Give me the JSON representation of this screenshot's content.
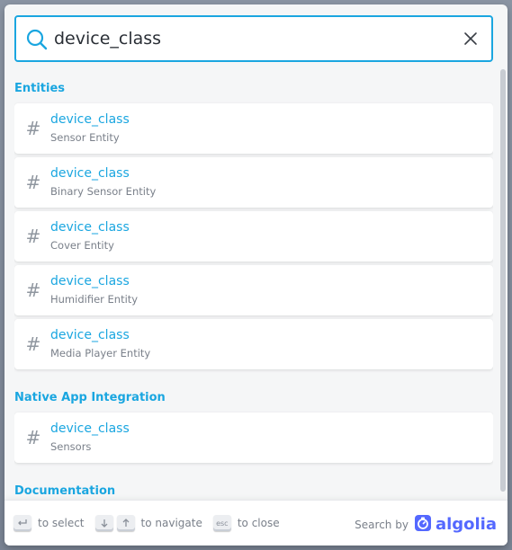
{
  "search": {
    "value": "device_class"
  },
  "sections": [
    {
      "title": "Entities",
      "hits": [
        {
          "title": "device_class",
          "path": "Sensor Entity"
        },
        {
          "title": "device_class",
          "path": "Binary Sensor Entity"
        },
        {
          "title": "device_class",
          "path": "Cover Entity"
        },
        {
          "title": "device_class",
          "path": "Humidifier Entity"
        },
        {
          "title": "device_class",
          "path": "Media Player Entity"
        }
      ]
    },
    {
      "title": "Native App Integration",
      "hits": [
        {
          "title": "device_class",
          "path": "Sensors"
        }
      ]
    },
    {
      "title": "Documentation",
      "hits": []
    }
  ],
  "footer": {
    "select_label": "to select",
    "navigate_label": "to navigate",
    "close_label": "to close",
    "esc_key": "esc",
    "search_by": "Search by",
    "brand": "algolia"
  },
  "colors": {
    "accent": "#1aa6e0",
    "algolia": "#5468ff"
  }
}
